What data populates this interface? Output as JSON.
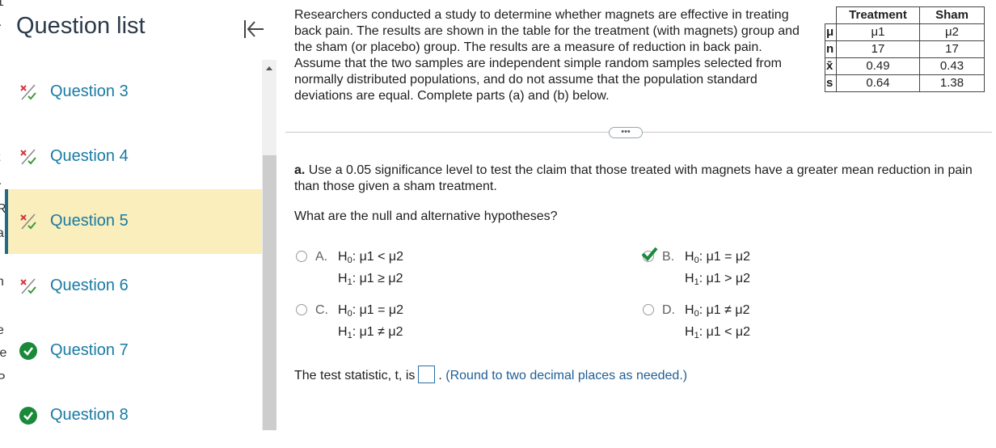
{
  "sidebar": {
    "title": "Question list",
    "items": [
      {
        "label": "Question 3",
        "status": "partial",
        "active": false
      },
      {
        "label": "Question 4",
        "status": "partial",
        "active": false
      },
      {
        "label": "Question 5",
        "status": "partial",
        "active": true
      },
      {
        "label": "Question 6",
        "status": "partial",
        "active": false
      },
      {
        "label": "Question 7",
        "status": "correct",
        "active": false
      },
      {
        "label": "Question 8",
        "status": "correct",
        "active": false
      }
    ]
  },
  "question": {
    "intro": "Researchers conducted a study to determine whether magnets are effective in treating back pain. The results are shown in the table for the treatment (with magnets) group and the sham (or placebo) group. The results are a measure of reduction in back pain. Assume that the two samples are independent simple random samples selected from normally distributed populations, and do not assume that the population standard deviations are equal. Complete parts (a) and (b) below.",
    "table": {
      "headers": [
        "Treatment",
        "Sham"
      ],
      "rows": [
        {
          "label": "μ",
          "values": [
            "μ1",
            "μ2"
          ]
        },
        {
          "label": "n",
          "values": [
            "17",
            "17"
          ]
        },
        {
          "label": "x̄",
          "values": [
            "0.49",
            "0.43"
          ]
        },
        {
          "label": "s",
          "values": [
            "0.64",
            "1.38"
          ]
        }
      ]
    },
    "more_label": "•••",
    "part_a_prefix": "a.",
    "part_a": "Use a 0.05 significance level to test the claim that those treated with magnets have a greater mean reduction in pain than those given a sham treatment.",
    "prompt": "What are the null and alternative hypotheses?",
    "options": [
      {
        "letter": "A.",
        "h0": "μ1 < μ2",
        "h1": "μ1 ≥ μ2",
        "selected": false
      },
      {
        "letter": "B.",
        "h0": "μ1 = μ2",
        "h1": "μ1 > μ2",
        "selected": true
      },
      {
        "letter": "C.",
        "h0": "μ1 = μ2",
        "h1": "μ1 ≠ μ2",
        "selected": false
      },
      {
        "letter": "D.",
        "h0": "μ1 ≠ μ2",
        "h1": "μ1 < μ2",
        "selected": false
      }
    ],
    "h0_label": "H",
    "h1_label": "H",
    "stat_prefix": "The test statistic, t, is",
    "stat_value": "",
    "stat_note": "(Round to two decimal places as needed.)"
  },
  "edge_fragments": [
    "1",
    "r",
    "t",
    "r",
    "R",
    "a",
    "h",
    "e",
    "le",
    "P"
  ],
  "colors": {
    "active_bg": "#f9eebc",
    "link": "#1a7aa3",
    "correct": "#1a8a3a",
    "partial_red": "#d9363e",
    "partial_green": "#3a9a3a"
  }
}
